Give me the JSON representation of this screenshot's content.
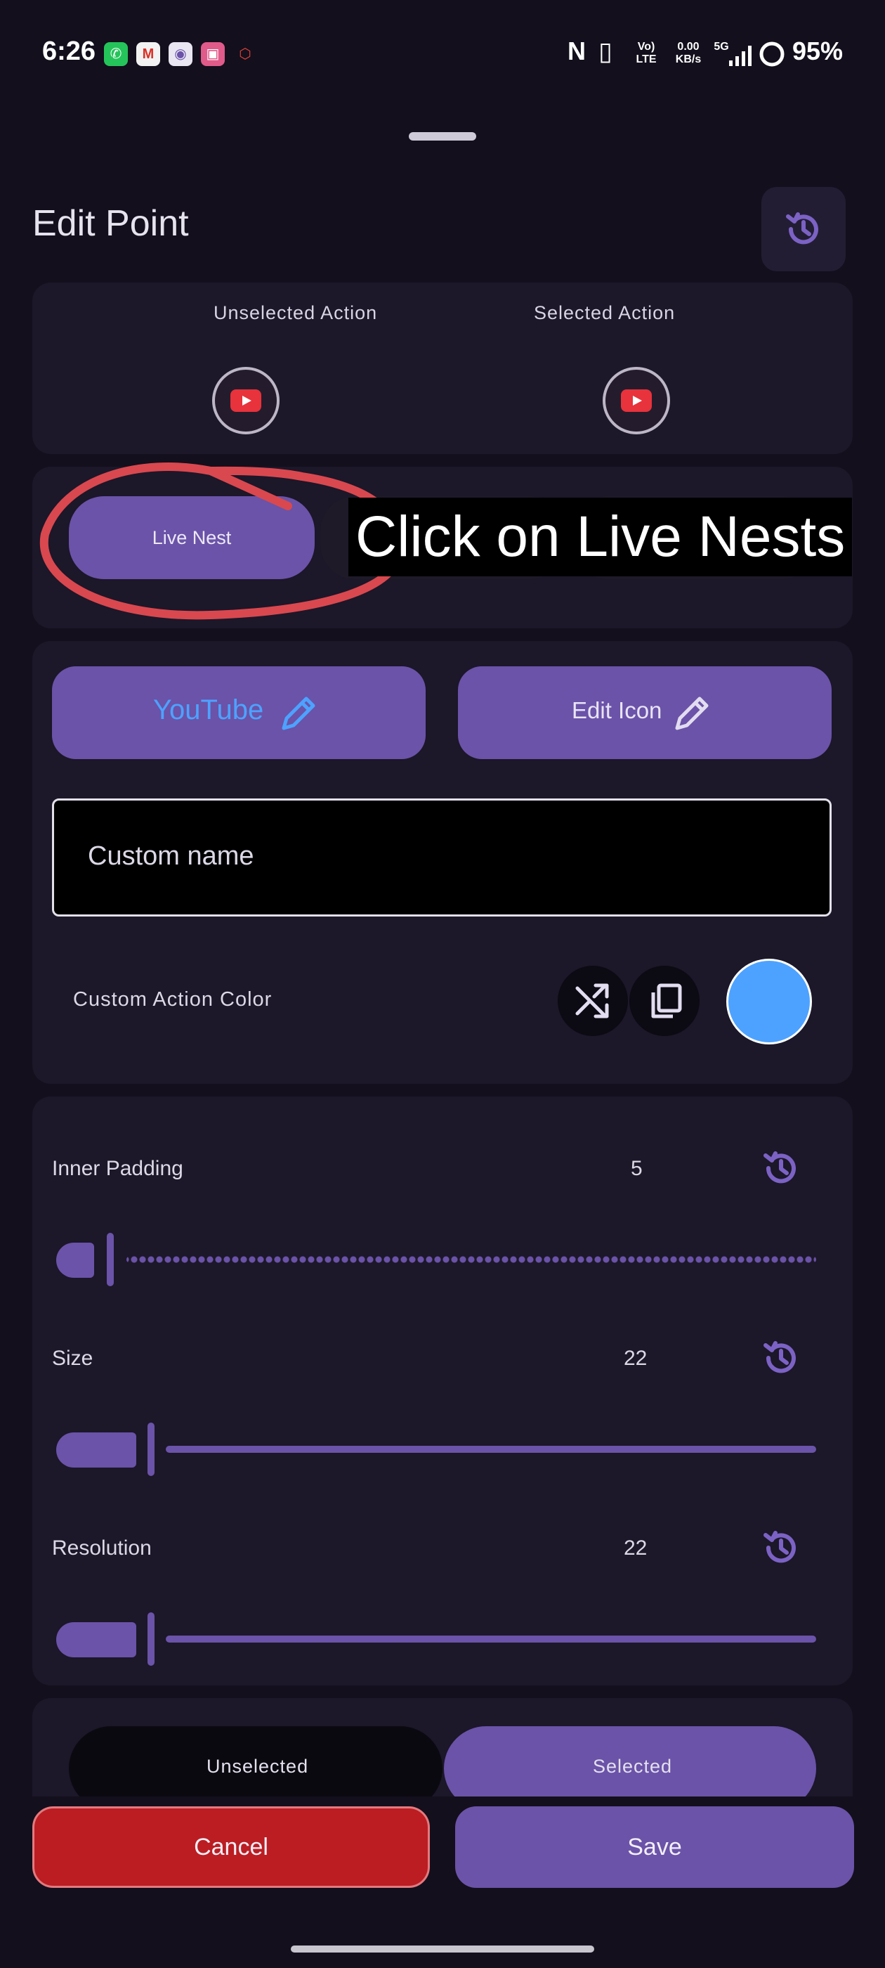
{
  "status_bar": {
    "time": "6:26",
    "network_speed": "0.00",
    "network_speed_unit": "KB/s",
    "volte": "Vo)",
    "lte": "LTE",
    "five_g": "5G",
    "battery": "95%",
    "notification_icons": [
      "whatsapp-icon",
      "gmail-icon",
      "app-icon",
      "app-icon",
      "app-icon"
    ],
    "status_icons": [
      "nfc-icon",
      "vibrate-icon",
      "signal-icon",
      "battery-icon"
    ]
  },
  "header": {
    "title": "Edit Point",
    "history_icon": "history-icon"
  },
  "actions": {
    "unselected_label": "Unselected Action",
    "selected_label": "Selected Action",
    "icon": "youtube-icon"
  },
  "tabs": {
    "active_label": "Live Nest"
  },
  "annotation": {
    "tooltip": "Click on Live Nests",
    "circle_color": "#d9484f"
  },
  "app_card": {
    "app_button_label": "YouTube",
    "app_button_color": "#4da2ff",
    "edit_icon_label": "Edit Icon",
    "custom_name_placeholder": "Custom name",
    "custom_color_label": "Custom Action Color",
    "swatch_color": "#4da2ff",
    "shuffle_icon": "shuffle-icon",
    "copy_icon": "copy-icon"
  },
  "sliders": [
    {
      "label": "Inner Padding",
      "value": "5"
    },
    {
      "label": "Size",
      "value": "22"
    },
    {
      "label": "Resolution",
      "value": "22"
    }
  ],
  "toggle": {
    "unselected_label": "Unselected",
    "selected_label": "Selected"
  },
  "footer": {
    "cancel_label": "Cancel",
    "save_label": "Save"
  },
  "colors": {
    "accent": "#6a53a8",
    "danger": "#bb1d22",
    "background": "#130f1c",
    "card": "#1c1729"
  }
}
